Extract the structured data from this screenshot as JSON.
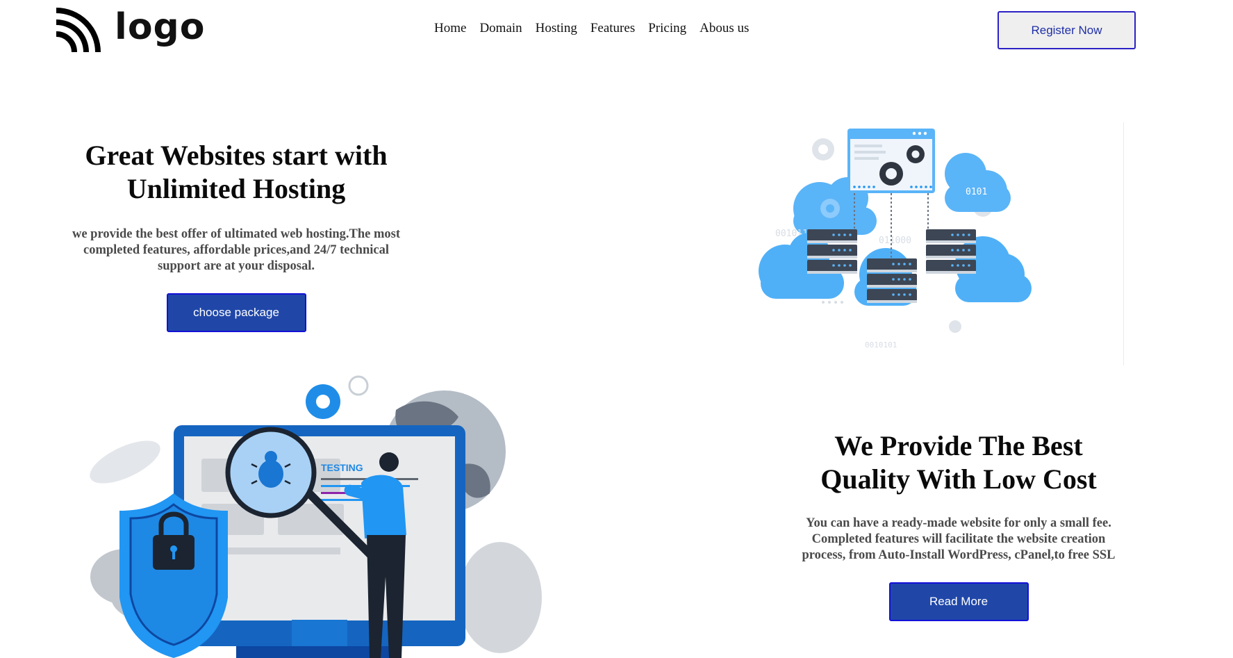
{
  "header": {
    "logo_text": "logo",
    "logo_icon": "wifi-arcs-icon",
    "nav": [
      "Home",
      "Domain",
      "Hosting",
      "Features",
      "Pricing",
      "Abous us"
    ],
    "register_label": "Register Now"
  },
  "hero": {
    "title_line1": "Great Websites start with",
    "title_line2": "Unlimited Hosting",
    "description": "we provide the best offer of ultimated web hosting.The most completed features, affordable prices,and 24/7 technical support are at your disposal.",
    "button_label": "choose package",
    "illustration_icon": "cloud-servers-illustration",
    "illustration_texts": [
      "0101",
      "0010110001011",
      "011000",
      "0010101"
    ]
  },
  "section2": {
    "title_line1": "We Provide The Best",
    "title_line2": "Quality With Low Cost",
    "description": "You can have a ready-made website for only a small fee. Completed features will facilitate the website creation process, from Auto-Install WordPress, cPanel,to free SSL",
    "button_label": "Read More",
    "illustration_icon": "bug-testing-illustration",
    "illustration_label": "TESTING"
  },
  "colors": {
    "primary_button": "#2047a8",
    "button_border": "#1410d8",
    "register_text": "#1f2fa8",
    "illustration_blue": "#2196f3",
    "illustration_light_blue": "#5ab4f8",
    "server_dark": "#3d4654"
  }
}
